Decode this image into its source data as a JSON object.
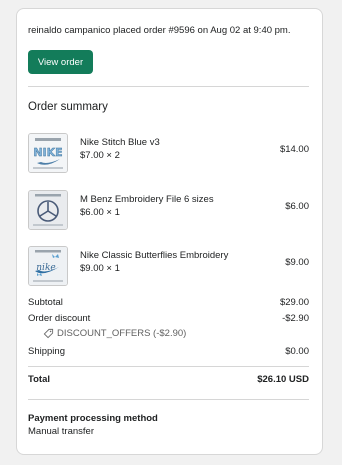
{
  "intro_text": "reinaldo campanico placed order #9596 on Aug 02 at 9:40 pm.",
  "view_order_label": "View order",
  "summary_title": "Order summary",
  "items": [
    {
      "name": "Nike Stitch Blue v3",
      "qty": "$7.00 × 2",
      "total": "$14.00",
      "thumb_icon": "nike-stitch-thumbnail"
    },
    {
      "name": "M Benz Embroidery File 6 sizes",
      "qty": "$6.00 × 1",
      "total": "$6.00",
      "thumb_icon": "mercedes-logo-thumbnail"
    },
    {
      "name": "Nike Classic Butterflies Embroidery",
      "qty": "$9.00 × 1",
      "total": "$9.00",
      "thumb_icon": "nike-butterflies-thumbnail"
    }
  ],
  "subtotal": {
    "label": "Subtotal",
    "value": "$29.00"
  },
  "discount": {
    "label": "Order discount",
    "value": "-$2.90",
    "code": "DISCOUNT_OFFERS (-$2.90)"
  },
  "shipping": {
    "label": "Shipping",
    "value": "$0.00"
  },
  "total": {
    "label": "Total",
    "value": "$26.10 USD"
  },
  "payment": {
    "title": "Payment processing method",
    "value": "Manual transfer"
  },
  "colors": {
    "button": "#137c5a",
    "divider": "#d6d6d6"
  }
}
